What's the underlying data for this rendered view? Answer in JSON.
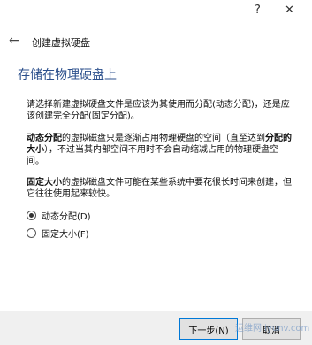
{
  "window": {
    "help_glyph": "?",
    "close_glyph": "✕"
  },
  "header": {
    "back_glyph": "←",
    "title": "创建虚拟硬盘"
  },
  "page": {
    "title": "存储在物理硬盘上",
    "intro": "请选择新建虚拟硬盘文件是应该为其使用而分配(动态分配)，还是应该创建完全分配(固定分配)。",
    "dynamic_bold": "动态分配",
    "dynamic_text": "的虚拟磁盘只是逐渐占用物理硬盘的空间（直至达到",
    "dynamic_bold2": "分配的大小",
    "dynamic_text2": "），不过当其内部空间不用时不会自动缩减占用的物理硬盘空间。",
    "fixed_bold": "固定大小",
    "fixed_text": "的虚拟磁盘文件可能在某些系统中要花很长时间来创建，但它往往使用起来较快。"
  },
  "options": [
    {
      "label": "动态分配(D)",
      "selected": true
    },
    {
      "label": "固定大小(F)",
      "selected": false
    }
  ],
  "buttons": {
    "next": "下一步(N)",
    "cancel": "取消"
  },
  "watermark": "运维网 iyunv.com"
}
